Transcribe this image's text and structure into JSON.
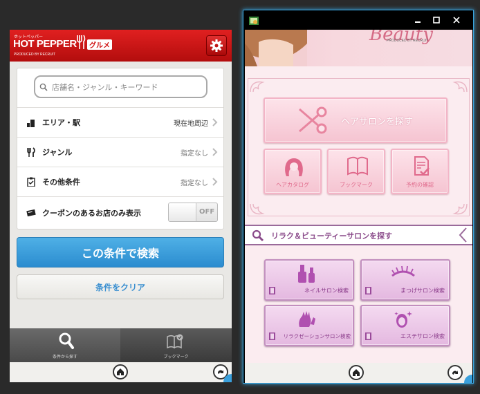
{
  "left_app": {
    "header": {
      "logo_small": "ホットペッパー",
      "logo_main": "HOT PEPPER",
      "logo_sub": "グルメ",
      "produced_by": "PRODUCED BY RECRUIT"
    },
    "search": {
      "placeholder": "店舗名・ジャンル・キーワード"
    },
    "rows": [
      {
        "label": "エリア・駅",
        "value": "現在地周辺",
        "icon": "building-icon"
      },
      {
        "label": "ジャンル",
        "value": "指定なし",
        "icon": "fork-knife-icon"
      },
      {
        "label": "その他条件",
        "value": "指定なし",
        "icon": "clipboard-check-icon"
      }
    ],
    "coupon_row": {
      "label": "クーポンのあるお店のみ表示",
      "toggle": "OFF"
    },
    "search_button": "この条件で検索",
    "clear_button": "条件をクリア",
    "tabs": [
      {
        "label": "条件から探す",
        "icon": "search-icon"
      },
      {
        "label": "ブックマーク",
        "icon": "bookmark-icon"
      }
    ]
  },
  "right_app": {
    "banner": {
      "logo": "Beauty",
      "produced_by": "PRODUCED BY RECRUIT"
    },
    "hair_salon_button": "ヘアサロンを探す",
    "small_buttons": [
      {
        "label": "ヘアカタログ",
        "icon": "hair-catalog-icon"
      },
      {
        "label": "ブックマーク",
        "icon": "book-icon"
      },
      {
        "label": "予約の確認",
        "icon": "reservation-check-icon"
      }
    ],
    "relax_bar": "リラク＆ビューティーサロンを探す",
    "purple_buttons": [
      {
        "label": "ネイルサロン検索",
        "icon": "nail-polish-icon"
      },
      {
        "label": "まつげサロン検索",
        "icon": "eyelash-icon"
      },
      {
        "label": "リラクゼーションサロン検索",
        "icon": "hands-icon"
      },
      {
        "label": "エステサロン検索",
        "icon": "face-sparkle-icon"
      }
    ]
  },
  "colors": {
    "hp_red": "#c91414",
    "hp_blue": "#3a9ad9",
    "beauty_pink": "#f5c4d1",
    "beauty_purple": "#e4b8e0",
    "window_border": "#3aa6e0"
  }
}
